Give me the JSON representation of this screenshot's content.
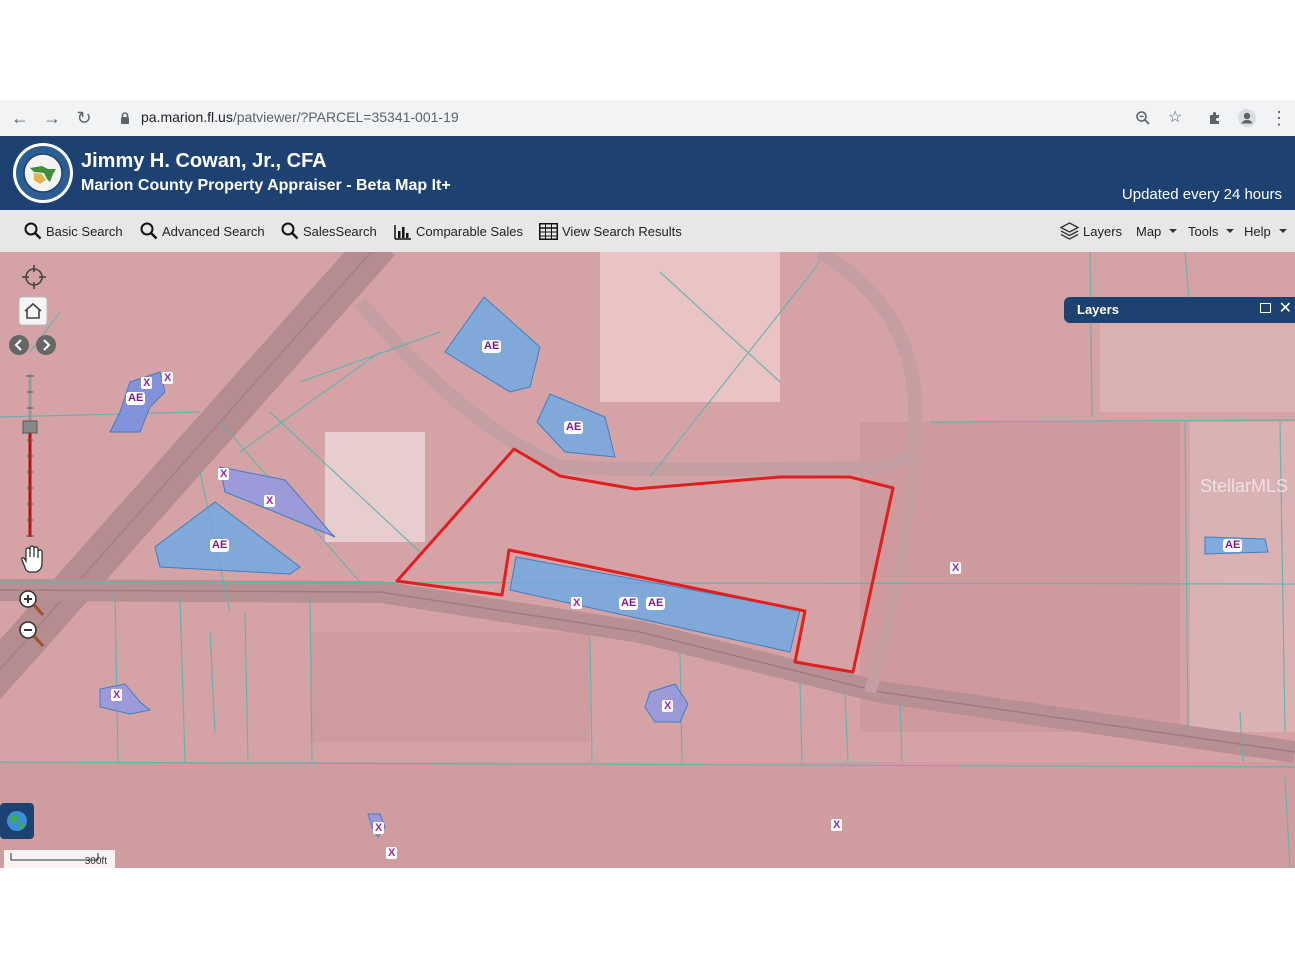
{
  "browser": {
    "url_domain": "pa.marion.fl.us",
    "url_path": "/patviewer/?PARCEL=35341-001-19"
  },
  "header": {
    "title": "Jimmy H. Cowan, Jr., CFA",
    "subtitle": "Marion County Property Appraiser - Beta Map It+",
    "update_note": "Updated every 24 hours"
  },
  "toolbar": {
    "basic_search": "Basic Search",
    "advanced_search": "Advanced Search",
    "sales_search": "SalesSearch",
    "comparable_sales": "Comparable Sales",
    "view_results": "View Search Results",
    "layers": "Layers",
    "map": "Map",
    "tools": "Tools",
    "help": "Help"
  },
  "layers_panel": {
    "title": "Layers"
  },
  "map": {
    "zone_ae": "AE",
    "zone_x": "X",
    "scale_label": "300ft",
    "watermark": "StellarMLS",
    "parcel_outline_color": "#e01f1f",
    "flood_zone_color": "#6aa9e6"
  }
}
